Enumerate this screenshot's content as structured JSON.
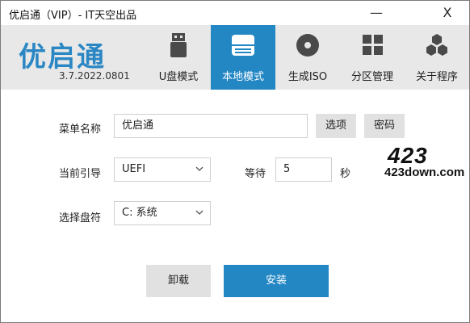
{
  "window": {
    "title": "优启通（VIP）- IT天空出品",
    "minimize": "—",
    "close": "X"
  },
  "header": {
    "logo": "优启通",
    "version": "3.7.2022.0801",
    "tabs": [
      {
        "label": "U盘模式",
        "icon": "usb-drive-icon",
        "active": false
      },
      {
        "label": "本地模式",
        "icon": "hard-drive-icon",
        "active": true
      },
      {
        "label": "生成ISO",
        "icon": "disc-icon",
        "active": false
      },
      {
        "label": "分区管理",
        "icon": "partition-grid-icon",
        "active": false
      },
      {
        "label": "关于程序",
        "icon": "hexagon-cluster-icon",
        "active": false
      }
    ],
    "accent": "#2387c4"
  },
  "form": {
    "menu_name_label": "菜单名称",
    "menu_name_value": "优启通",
    "options_button": "选项",
    "password_button": "密码",
    "boot_label": "当前引导",
    "boot_value": "UEFI",
    "wait_label": "等待",
    "wait_value": "5",
    "wait_unit": "秒",
    "disk_label": "选择盘符",
    "disk_value": "C: 系统"
  },
  "actions": {
    "uninstall": "卸载",
    "install": "安装"
  },
  "watermark": {
    "line1": "423",
    "line2": "423down.com"
  }
}
